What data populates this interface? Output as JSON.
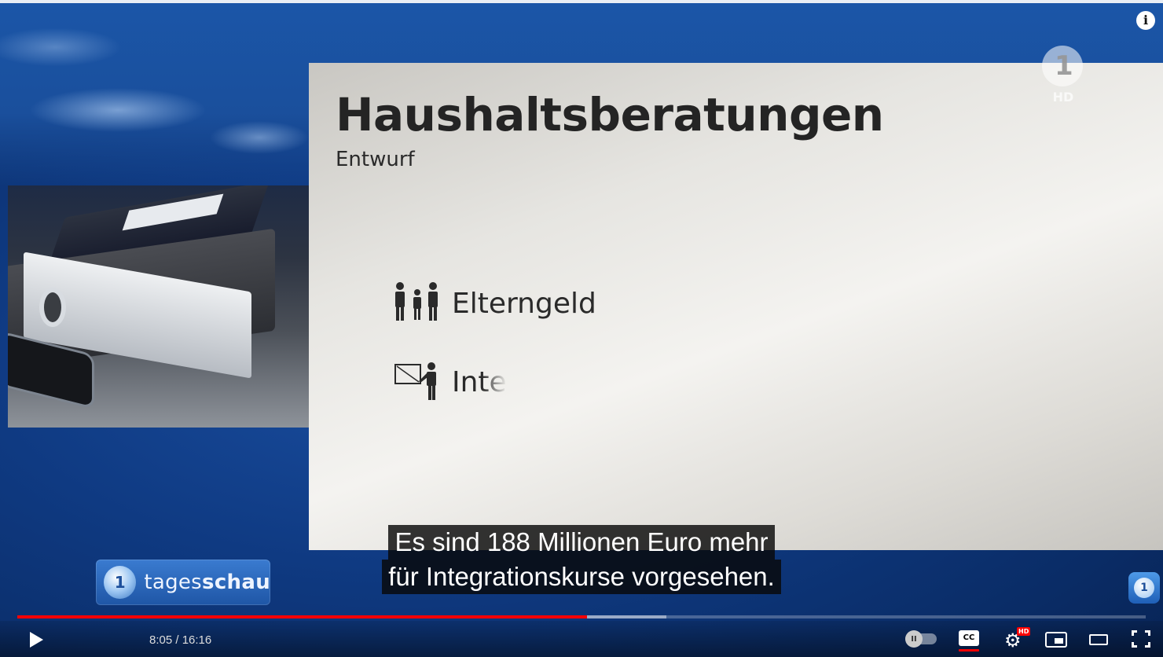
{
  "video": {
    "card": {
      "title": "Haushaltsberatungen",
      "subtitle": "Entwurf",
      "items": [
        {
          "label": "Elterngeld",
          "icon": "family-icon"
        },
        {
          "label": "Inte",
          "icon": "classroom-icon"
        }
      ]
    },
    "channel_logo": {
      "prefix": "tages",
      "suffix": "schau",
      "glyph": "1"
    },
    "broadcaster_logo": {
      "glyph": "1",
      "quality": "HD"
    },
    "captions": [
      "Es sind 188 Millionen Euro mehr",
      "für Integrationskurse vorgesehen."
    ]
  },
  "player": {
    "info_glyph": "i",
    "time_display": "8:05 / 16:16",
    "progress": {
      "played_fraction": 0.505,
      "buffered_fraction": 0.575
    },
    "colors": {
      "played": "#ff0000",
      "accent": "#ff0000"
    },
    "controls": {
      "autoplay_glyph": "II",
      "cc_label": "CC",
      "settings_badge": "HD",
      "settings_glyph": "⚙"
    }
  }
}
